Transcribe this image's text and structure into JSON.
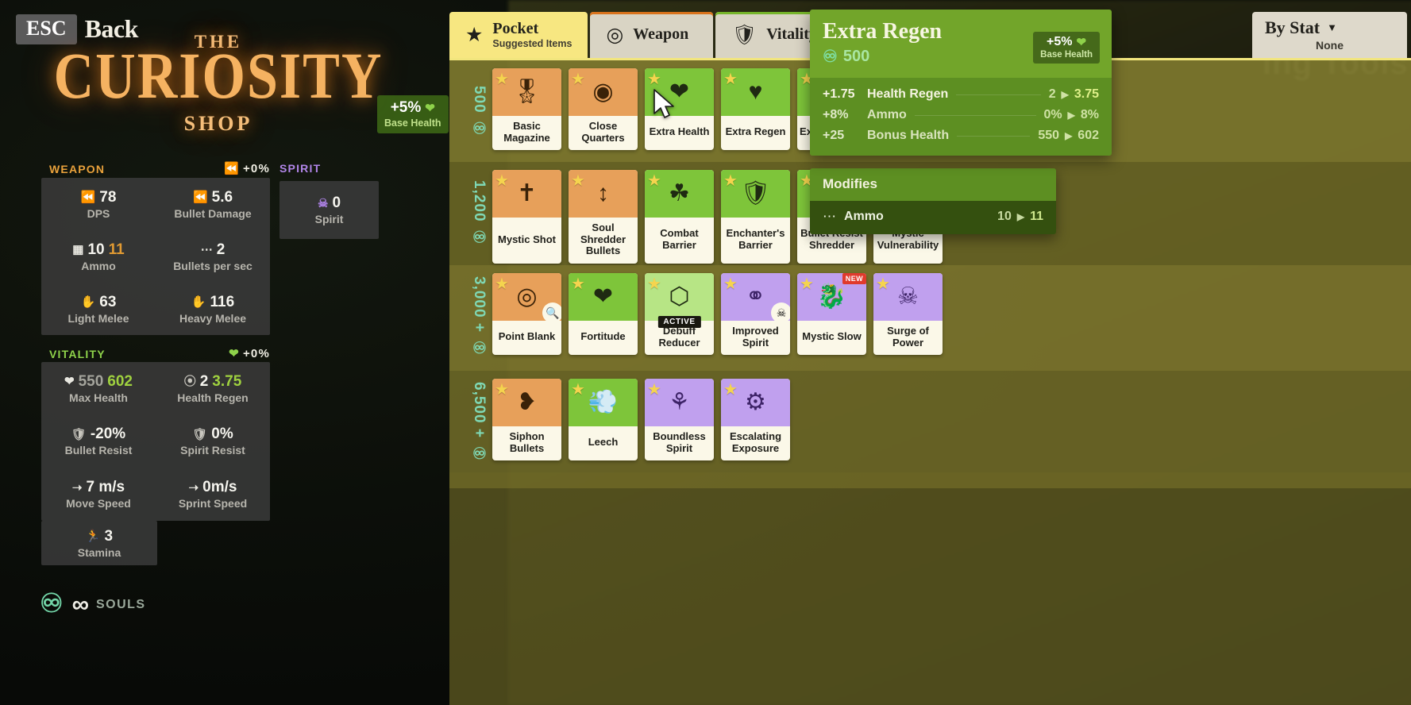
{
  "left": {
    "esc_key": "ESC",
    "back_label": "Back",
    "logo": {
      "the": "THE",
      "main": "CURIOSITY",
      "shop": "SHOP"
    },
    "base_health_badge": {
      "value": "+5%",
      "icon": "heart-icon",
      "label": "Base Health"
    },
    "categories": [
      {
        "name": "WEAPON",
        "pct": "+0%",
        "pct_icon": "weapon-icon"
      },
      {
        "name": "SPIRIT",
        "pct": "",
        "pct_icon": ""
      },
      {
        "name": "VITALITY",
        "pct": "+0%",
        "pct_icon": "heart-icon"
      }
    ],
    "weapon_stats": [
      {
        "icon": "weapon-icon",
        "icon_color": "white",
        "value": "78",
        "label": "DPS"
      },
      {
        "icon": "weapon-icon",
        "icon_color": "orange",
        "value": "5.6",
        "label": "Bullet Damage"
      },
      {
        "icon": "magazine-icon",
        "icon_color": "white",
        "value": "10",
        "new_value": "11",
        "label": "Ammo"
      },
      {
        "icon": "fire-rate-icon",
        "icon_color": "white",
        "value": "2",
        "label": "Bullets per sec"
      },
      {
        "icon": "fist-icon",
        "icon_color": "white",
        "value": "63",
        "label": "Light Melee"
      },
      {
        "icon": "fist-icon",
        "icon_color": "white",
        "value": "116",
        "label": "Heavy Melee"
      }
    ],
    "spirit_stats": [
      {
        "icon": "spirit-icon",
        "icon_color": "purple",
        "value": "0",
        "label": "Spirit"
      }
    ],
    "vitality_stats": [
      {
        "icon": "heart-icon",
        "icon_color": "white",
        "value": "550",
        "new_value": "602",
        "label": "Max Health"
      },
      {
        "icon": "regen-icon",
        "icon_color": "gray",
        "value": "2",
        "new_value": "3.75",
        "label": "Health Regen"
      },
      {
        "icon": "shield-icon",
        "icon_color": "gray",
        "value": "-20%",
        "label": "Bullet Resist"
      },
      {
        "icon": "shield-icon",
        "icon_color": "gray",
        "value": "0%",
        "label": "Spirit Resist"
      },
      {
        "icon": "boot-icon",
        "icon_color": "white",
        "value": "7 m/s",
        "label": "Move Speed"
      },
      {
        "icon": "boot-icon",
        "icon_color": "white",
        "value": "0m/s",
        "label": "Sprint Speed"
      }
    ],
    "stamina_stat": {
      "icon": "stamina-icon",
      "value": "3",
      "label": "Stamina"
    },
    "souls": {
      "orb_icon": "souls-orb-icon",
      "amount_icon": "infinity-icon",
      "label": "SOULS"
    }
  },
  "shop": {
    "tabs": [
      {
        "icon": "star-icon",
        "title": "Pocket",
        "subtitle": "Suggested Items",
        "active": true,
        "accent": "#f2e67e"
      },
      {
        "icon": "weapon-target-icon",
        "title": "Weapon",
        "subtitle": "",
        "active": false,
        "accent": "#d9731c"
      },
      {
        "icon": "vitality-shield-icon",
        "title": "Vitality",
        "subtitle": "",
        "active": false,
        "accent": "#76b52a"
      }
    ],
    "sort": {
      "label": "By Stat",
      "value": "None",
      "caret_icon": "chevron-down-icon"
    },
    "background_text": "ing Tools",
    "rows": [
      {
        "price": "500",
        "items": [
          {
            "name": "Basic Magazine",
            "category": "weapon",
            "glyph": "magazine",
            "art": "orange",
            "badge": ""
          },
          {
            "name": "Close Quarters",
            "category": "weapon",
            "glyph": "scope",
            "art": "orange",
            "badge": ""
          },
          {
            "name": "Extra Health",
            "category": "vitality",
            "glyph": "heart",
            "art": "green",
            "badge": ""
          },
          {
            "name": "Extra Regen",
            "category": "vitality",
            "glyph": "heart-bar",
            "art": "green",
            "badge": ""
          },
          {
            "name": "Extra Charge",
            "category": "vitality",
            "glyph": "heart",
            "art": "green",
            "badge": ""
          }
        ]
      },
      {
        "price": "1,200",
        "items": [
          {
            "name": "Mystic Shot",
            "category": "weapon",
            "glyph": "mystic-shot",
            "art": "orange",
            "badge": ""
          },
          {
            "name": "Soul Shredder Bullets",
            "category": "weapon",
            "glyph": "shredder",
            "art": "orange",
            "badge": ""
          },
          {
            "name": "Combat Barrier",
            "category": "vitality",
            "glyph": "barrier",
            "art": "green",
            "badge": ""
          },
          {
            "name": "Enchanter's Barrier",
            "category": "vitality",
            "glyph": "shield-bolt",
            "art": "green",
            "badge": ""
          },
          {
            "name": "Bullet Resist Shredder",
            "category": "vitality",
            "glyph": "shredder-alt",
            "art": "green",
            "badge": ""
          },
          {
            "name": "Mystic Vulnerability",
            "category": "spirit",
            "glyph": "mystic-vuln",
            "art": "purple",
            "badge": ""
          }
        ]
      },
      {
        "price": "3,000 +",
        "items": [
          {
            "name": "Point Blank",
            "category": "weapon",
            "glyph": "point-blank",
            "art": "orange",
            "badge": ""
          },
          {
            "name": "Fortitude",
            "category": "vitality",
            "glyph": "sparkle-heart",
            "art": "green",
            "badge": ""
          },
          {
            "name": "Debuff Reducer",
            "category": "vitality",
            "glyph": "debuff",
            "art": "green-light",
            "badge": "ACTIVE"
          },
          {
            "name": "Improved Spirit",
            "category": "spirit",
            "glyph": "spirit-swirl",
            "art": "purple",
            "badge": ""
          },
          {
            "name": "Mystic Slow",
            "category": "spirit",
            "glyph": "mystic-slow",
            "art": "purple",
            "badge": "NEW"
          },
          {
            "name": "Surge of Power",
            "category": "spirit",
            "glyph": "surge",
            "art": "purple",
            "badge": ""
          }
        ]
      },
      {
        "price": "6,500 +",
        "items": [
          {
            "name": "Siphon Bullets",
            "category": "weapon",
            "glyph": "siphon",
            "art": "orange",
            "badge": ""
          },
          {
            "name": "Leech",
            "category": "vitality",
            "glyph": "leech",
            "art": "green",
            "badge": ""
          },
          {
            "name": "Boundless Spirit",
            "category": "spirit",
            "glyph": "boundless",
            "art": "purple",
            "badge": ""
          },
          {
            "name": "Escalating Exposure",
            "category": "spirit",
            "glyph": "escalating",
            "art": "purple",
            "badge": ""
          }
        ]
      }
    ]
  },
  "tooltip": {
    "title": "Extra Regen",
    "cost": "500",
    "cost_icon": "souls-orb-icon",
    "badge": {
      "value": "+5%",
      "icon": "shield-heart-icon",
      "label": "Base Health"
    },
    "stats": [
      {
        "delta": "+1.75",
        "name": "Health Regen",
        "old": "2",
        "new": "3.75",
        "primary": true
      },
      {
        "delta": "+8%",
        "name": "Ammo",
        "old": "0%",
        "new": "8%",
        "primary": false
      },
      {
        "delta": "+25",
        "name": "Bonus Health",
        "old": "550",
        "new": "602",
        "primary": false
      }
    ],
    "modifies": {
      "header": "Modifies",
      "rows": [
        {
          "icon": "ammo-icon",
          "name": "Ammo",
          "old": "10",
          "new": "11"
        }
      ]
    }
  },
  "colors": {
    "accent_yellow": "#f2e67e",
    "weapon_orange": "#d9731c",
    "vitality_green": "#76b52a",
    "spirit_purple": "#b185e8",
    "souls_teal": "#7fd8b4",
    "tooltip_green": "#72a52a"
  }
}
